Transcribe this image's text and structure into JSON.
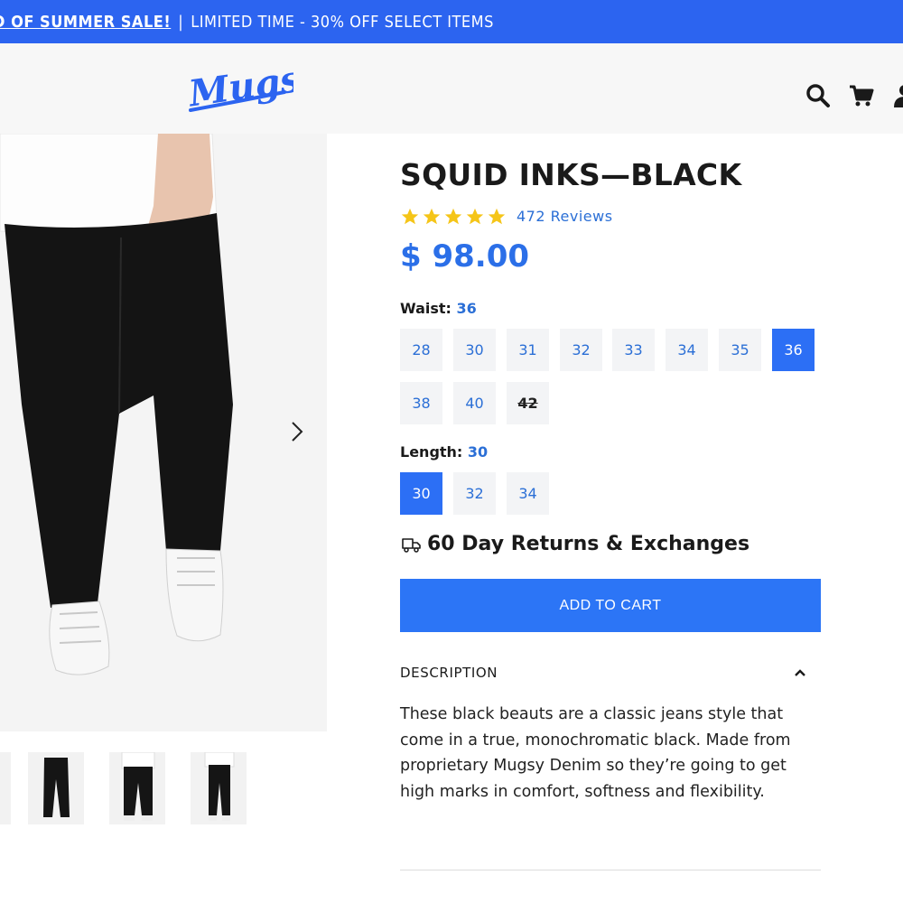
{
  "promo": {
    "sale_text": "D OF SUMMER SALE!",
    "separator": "|",
    "detail_text": "LIMITED TIME - 30% OFF SELECT ITEMS"
  },
  "header": {
    "logo_text": "Mugsy",
    "icons": [
      "search-icon",
      "cart-icon",
      "user-icon"
    ]
  },
  "gallery": {
    "thumbnails": [
      "thumb-flat",
      "thumb-front",
      "thumb-back"
    ]
  },
  "product": {
    "title": "SQUID INKS—BLACK",
    "rating": 5,
    "reviews_label": "472 Reviews",
    "price": "$ 98.00"
  },
  "waist": {
    "label": "Waist:",
    "selected": "36",
    "options": [
      "28",
      "30",
      "31",
      "32",
      "33",
      "34",
      "35",
      "36",
      "38",
      "40",
      "42"
    ],
    "unavailable": [
      "42"
    ]
  },
  "length": {
    "label": "Length:",
    "selected": "30",
    "options": [
      "30",
      "32",
      "34"
    ]
  },
  "returns": {
    "label": "60 Day Returns & Exchanges"
  },
  "cart": {
    "button_label": "ADD TO CART"
  },
  "description": {
    "heading": "DESCRIPTION",
    "body": "These black beauts are a classic jeans style that come in a true, monochromatic black. Made from proprietary Mugsy Denim so they’re going to get high marks in comfort, softness and flexibility."
  },
  "colors": {
    "brand_blue": "#2c64f0",
    "link_blue": "#2b6fd6",
    "star_gold": "#f5c518"
  }
}
